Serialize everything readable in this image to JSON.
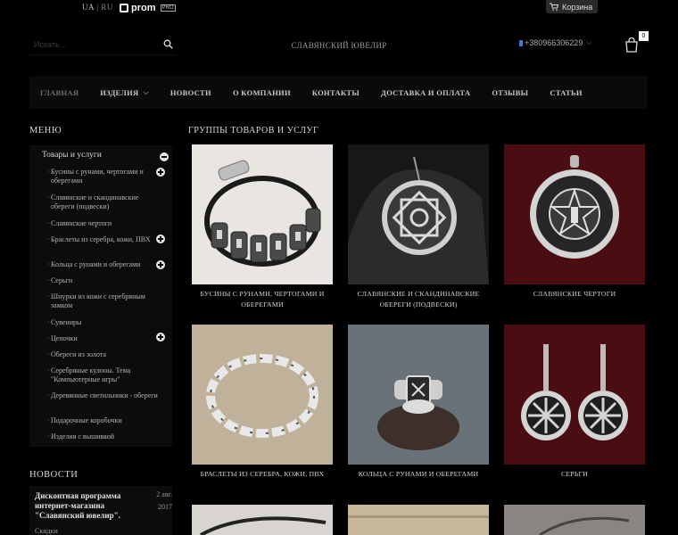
{
  "topbar": {
    "lang_ua": "UA",
    "lang_sep": "|",
    "lang_ru": "RU",
    "prom_logo": "prom",
    "prom_badge": "PRO",
    "cart_label": "Корзина"
  },
  "header": {
    "search_placeholder": "Искать...",
    "brand": "СЛАВЯНСКИЙ ЮВЕЛИР",
    "phone": "+380966306229",
    "cart_count": "0"
  },
  "nav": {
    "items": [
      "ГЛАВНАЯ",
      "ИЗДЕЛИЯ",
      "НОВОСТИ",
      "О КОМПАНИИ",
      "КОНТАКТЫ",
      "ДОСТАВКА И ОПЛАТА",
      "ОТЗЫВЫ",
      "СТАТЬИ"
    ]
  },
  "sidebar": {
    "heading": "МЕНЮ",
    "root": "Товары и услуги",
    "items": [
      "Бусины с рунами, чертогами и оберегами",
      "Славянские и скандинавские обереги (подвески)",
      "Славянские чертоги",
      "Браслеты из серебра, кожи, ПВХ",
      "Кольца с рунами и оберегами",
      "Серьги",
      "Шнурки из кожи с серебряным замком",
      "Сувениры",
      "Цепочки",
      "Обереги из золота",
      "Серебряные кулоны. Тема \"Компьютерные игры\"",
      "Деревянные светильники - обереги",
      "Подарочные коробочки",
      "Изделия с вышивкой"
    ]
  },
  "news": {
    "heading": "НОВОСТИ",
    "title": "Дисконтная программа интернет-магазина \"Славянский ювелир\".",
    "date_day": "2 авг.",
    "date_year": "2017",
    "tag": "Скидки"
  },
  "main": {
    "heading": "ГРУППЫ ТОВАРОВ И УСЛУГ",
    "cards": [
      "БУСИНЫ С РУНАМИ, ЧЕРТОГАМИ И ОБЕРЕГАМИ",
      "СЛАВЯНСКИЕ И СКАНДИНАВСКИЕ ОБЕРЕГИ (ПОДВЕСКИ)",
      "СЛАВЯНСКИЕ ЧЕРТОГИ",
      "БРАСЛЕТЫ ИЗ СЕРЕБРА, КОЖИ, ПВХ",
      "КОЛЬЦА С РУНАМИ И ОБЕРЕГАМИ",
      "СЕРЬГИ"
    ]
  },
  "colors": {
    "background": "#000000",
    "nav_bg": "#0a0a0a",
    "panel_bg": "#0c0c0c",
    "accent_blue": "#3a7ad8"
  }
}
